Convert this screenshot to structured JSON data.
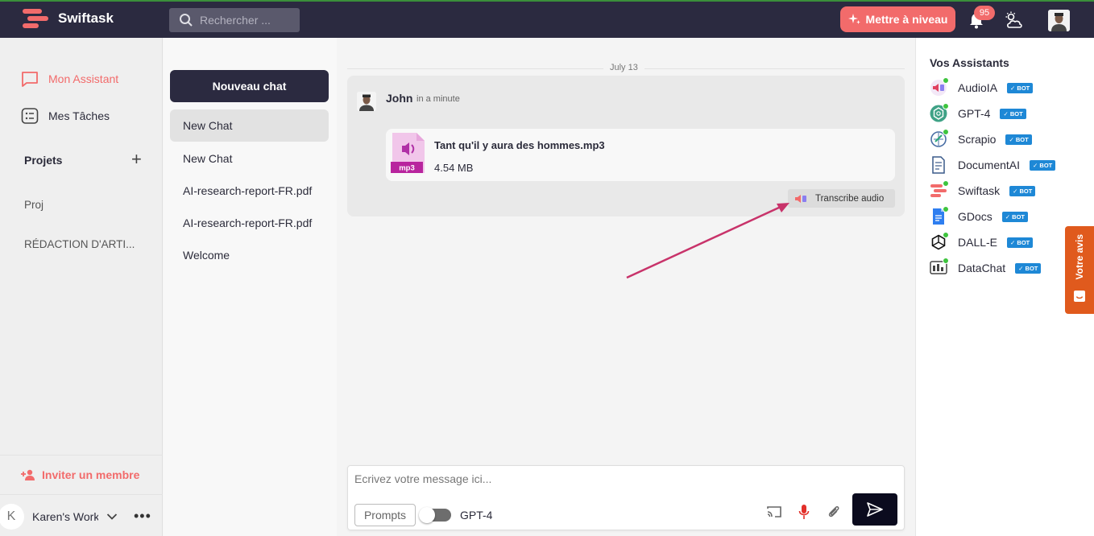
{
  "app": {
    "name": "Swiftask"
  },
  "topbar": {
    "search_placeholder": "Rechercher ...",
    "upgrade_label": "Mettre à niveau",
    "notification_count": "95"
  },
  "leftbar": {
    "nav": [
      {
        "label": "Mon Assistant",
        "icon": "chat-bubble-icon",
        "active": true
      },
      {
        "label": "Mes Tâches",
        "icon": "tasks-icon",
        "active": false
      }
    ],
    "projects_title": "Projets",
    "projects": [
      "Proj",
      "RÉDACTION D'ARTI..."
    ],
    "invite_label": "Inviter un membre",
    "workspace": {
      "initial": "K",
      "name": "Karen's Work"
    }
  },
  "chatlist": {
    "new_chat_label": "Nouveau chat",
    "items": [
      "New Chat",
      "New Chat",
      "AI-research-report-FR.pdf",
      "AI-research-report-FR.pdf",
      "Welcome"
    ]
  },
  "main": {
    "date_label": "July 13",
    "message": {
      "author": "John",
      "time": "in a minute",
      "file": {
        "name": "Tant qu'il y aura des hommes.mp3",
        "size": "4.54 MB",
        "type_label": "mp3"
      },
      "transcribe_label": "Transcribe audio"
    },
    "composer": {
      "placeholder": "Ecrivez votre message ici...",
      "prompts_label": "Prompts",
      "model_label": "GPT-4"
    }
  },
  "rightbar": {
    "title": "Vos Assistants",
    "badge_label": "✓ BOT",
    "assistants": [
      {
        "name": "AudioIA",
        "icon": "audio-icon"
      },
      {
        "name": "GPT-4",
        "icon": "openai-icon"
      },
      {
        "name": "Scrapio",
        "icon": "scraper-icon"
      },
      {
        "name": "DocumentAI",
        "icon": "document-icon"
      },
      {
        "name": "Swiftask",
        "icon": "swiftask-logo-icon"
      },
      {
        "name": "GDocs",
        "icon": "google-docs-icon"
      },
      {
        "name": "DALL-E",
        "icon": "openai-icon"
      },
      {
        "name": "DataChat",
        "icon": "datachat-icon"
      }
    ]
  },
  "feedback_label": "Votre avis",
  "colors": {
    "brand": "#f26b6b",
    "navy": "#2b2a40",
    "bot_badge": "#1e88d6",
    "online": "#3ec43e",
    "feedback": "#e05a1d"
  }
}
